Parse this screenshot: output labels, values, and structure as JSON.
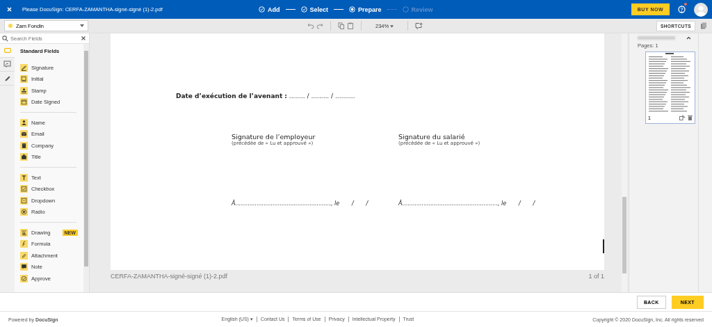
{
  "header": {
    "title": "Please DocuSign: CERFA-ZAMANTHA-signé-signé (1)-2.pdf",
    "steps": [
      {
        "label": "Add",
        "done": true,
        "selected": false
      },
      {
        "label": "Select",
        "done": true,
        "selected": false
      },
      {
        "label": "Prepare",
        "done": false,
        "selected": true
      },
      {
        "label": "Review",
        "done": false,
        "selected": false
      }
    ],
    "buy_button": "BUY NOW",
    "help_notification": true
  },
  "toolbar": {
    "recipient": "Zam Fondin",
    "zoom": "234%",
    "shortcuts_button": "SHORTCUTS"
  },
  "sidebar": {
    "search": {
      "placeholder": "Search Fields"
    },
    "rail": [
      {
        "selected": true
      },
      {
        "selected": false
      },
      {
        "selected": false
      }
    ],
    "heading": "Standard Fields",
    "groups": [
      [
        {
          "label": "Signature"
        },
        {
          "label": "Initial"
        },
        {
          "label": "Stamp"
        },
        {
          "label": "Date Signed"
        }
      ],
      [
        {
          "label": "Name"
        },
        {
          "label": "Email"
        },
        {
          "label": "Company"
        },
        {
          "label": "Title"
        }
      ],
      [
        {
          "label": "Text"
        },
        {
          "label": "Checkbox"
        },
        {
          "label": "Dropdown"
        },
        {
          "label": "Radio"
        }
      ],
      [
        {
          "label": "Drawing",
          "badge": "NEW"
        },
        {
          "label": "Formula"
        },
        {
          "label": "Attachment"
        },
        {
          "label": "Note"
        },
        {
          "label": "Approve"
        }
      ]
    ]
  },
  "document": {
    "date_line": "**Date d’exécution de l’avenant :** ........ / ......... / ..........",
    "signatures": [
      {
        "heading": "Signature de l’employeur",
        "note": "(précédée de « Lu et approuvé »)",
        "line": "À......................................................, le       /       /"
      },
      {
        "heading": "Signature du salarié",
        "note": "(précédée de « Lu et approuvé »)",
        "line": "À......................................................, le       /       /"
      }
    ],
    "file_name": "CERFA-ZAMANTHA-signé-signé (1)-2.pdf",
    "page_count": "1 of 1"
  },
  "pages_panel": {
    "pages_label": "Pages: 1",
    "thumbnail_number": "1"
  },
  "actions": {
    "back": "BACK",
    "next": "NEXT"
  },
  "footer": {
    "powered": "Powered by **DocuSign**",
    "language": "English (US) ▾",
    "links": [
      "Contact Us",
      "Terms of Use",
      "Privacy",
      "Intellectual Property",
      "Trust"
    ],
    "copyright": "Copyright © 2020 DocuSign, Inc. All rights reserved"
  }
}
